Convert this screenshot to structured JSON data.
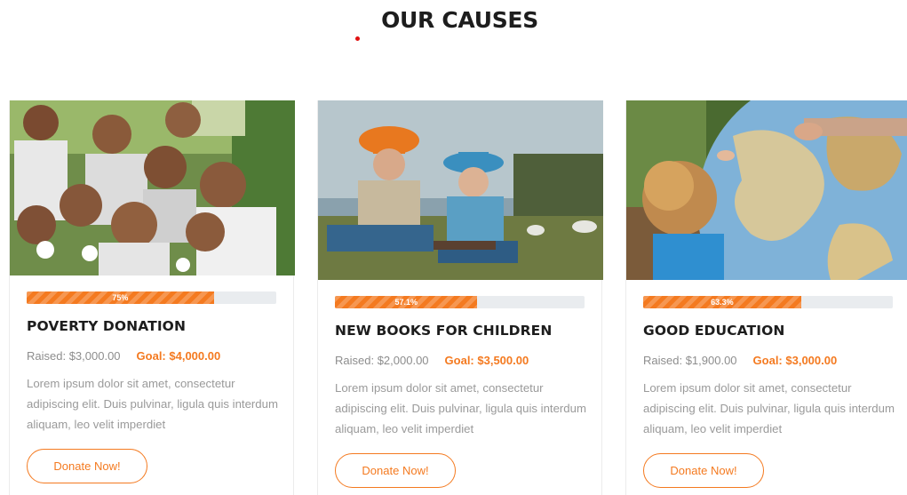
{
  "section": {
    "title": "OUR CAUSES"
  },
  "colors": {
    "accent": "#f47a20",
    "title_dot": "#e01010",
    "track": "#e9ecef"
  },
  "causes": [
    {
      "image": "children-group-photo",
      "progress_label": "75%",
      "progress": 0.75,
      "title": "POVERTY DONATION",
      "raised": "Raised: $3,000.00",
      "goal": "Goal: $4,000.00",
      "description": "Lorem ipsum dolor sit amet, consectetur adipiscing elit. Duis pulvinar, ligula quis interdum aliquam, leo velit imperdiet",
      "button": "Donate Now!"
    },
    {
      "image": "kids-reading-in-grass-photo",
      "progress_label": "57.1%",
      "progress": 0.571,
      "title": "NEW BOOKS FOR CHILDREN",
      "raised": "Raised: $2,000.00",
      "goal": "Goal: $3,500.00",
      "description": "Lorem ipsum dolor sit amet, consectetur adipiscing elit. Duis pulvinar, ligula quis interdum aliquam, leo velit imperdiet",
      "button": "Donate Now!"
    },
    {
      "image": "child-with-globe-photo",
      "progress_label": "63.3%",
      "progress": 0.633,
      "title": "GOOD EDUCATION",
      "raised": "Raised: $1,900.00",
      "goal": "Goal: $3,000.00",
      "description": "Lorem ipsum dolor sit amet, consectetur adipiscing elit. Duis pulvinar, ligula quis interdum aliquam, leo velit imperdiet",
      "button": "Donate Now!"
    }
  ]
}
